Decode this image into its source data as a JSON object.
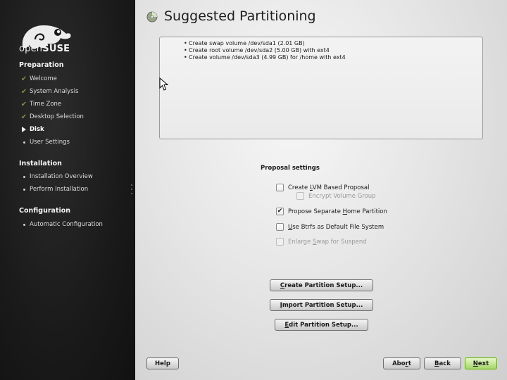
{
  "sidebar": {
    "logo_text_light": "open",
    "logo_text_bold": "SUSE",
    "sections": [
      {
        "title": "Preparation",
        "items": [
          {
            "label": "Welcome",
            "state": "done"
          },
          {
            "label": "System Analysis",
            "state": "done"
          },
          {
            "label": "Time Zone",
            "state": "done"
          },
          {
            "label": "Desktop Selection",
            "state": "done"
          },
          {
            "label": "Disk",
            "state": "current"
          },
          {
            "label": "User Settings",
            "state": "pending"
          }
        ]
      },
      {
        "title": "Installation",
        "items": [
          {
            "label": "Installation Overview",
            "state": "pending"
          },
          {
            "label": "Perform Installation",
            "state": "pending"
          }
        ]
      },
      {
        "title": "Configuration",
        "items": [
          {
            "label": "Automatic Configuration",
            "state": "pending"
          }
        ]
      }
    ]
  },
  "main": {
    "title": "Suggested Partitioning",
    "summary": [
      "Create swap volume /dev/sda1 (2.01 GB)",
      "Create root volume /dev/sda2 (5.00 GB) with ext4",
      "Create volume /dev/sda3 (4.99 GB) for /home with ext4"
    ],
    "proposal": {
      "title": "Proposal settings",
      "options": [
        {
          "pre": "Create ",
          "key": "L",
          "post": "VM Based Proposal",
          "checked": false,
          "enabled": true
        },
        {
          "pre": "",
          "key": "",
          "post": "Encrypt Volume Group",
          "checked": false,
          "enabled": false
        },
        {
          "pre": "Propose Separate ",
          "key": "H",
          "post": "ome Partition",
          "checked": true,
          "enabled": true
        },
        {
          "pre": "",
          "key": "U",
          "post": "se Btrfs as Default File System",
          "checked": false,
          "enabled": true
        },
        {
          "pre": "Enlarge ",
          "key": "S",
          "post": "wap for Suspend",
          "checked": false,
          "enabled": false
        }
      ]
    },
    "actions": [
      {
        "pre": "",
        "key": "C",
        "post": "reate Partition Setup..."
      },
      {
        "pre": "",
        "key": "I",
        "post": "mport Partition Setup..."
      },
      {
        "pre": "",
        "key": "E",
        "post": "dit Partition Setup..."
      }
    ]
  },
  "footer": {
    "help": "Help",
    "abort": {
      "pre": "Abo",
      "key": "r",
      "post": "t"
    },
    "back": {
      "pre": "",
      "key": "B",
      "post": "ack"
    },
    "next": {
      "pre": "",
      "key": "N",
      "post": "ext"
    }
  },
  "colors": {
    "sidebar_bg": "#1a1a1a",
    "done_check": "#7c8f4a",
    "next_button": "#a6d86b"
  }
}
